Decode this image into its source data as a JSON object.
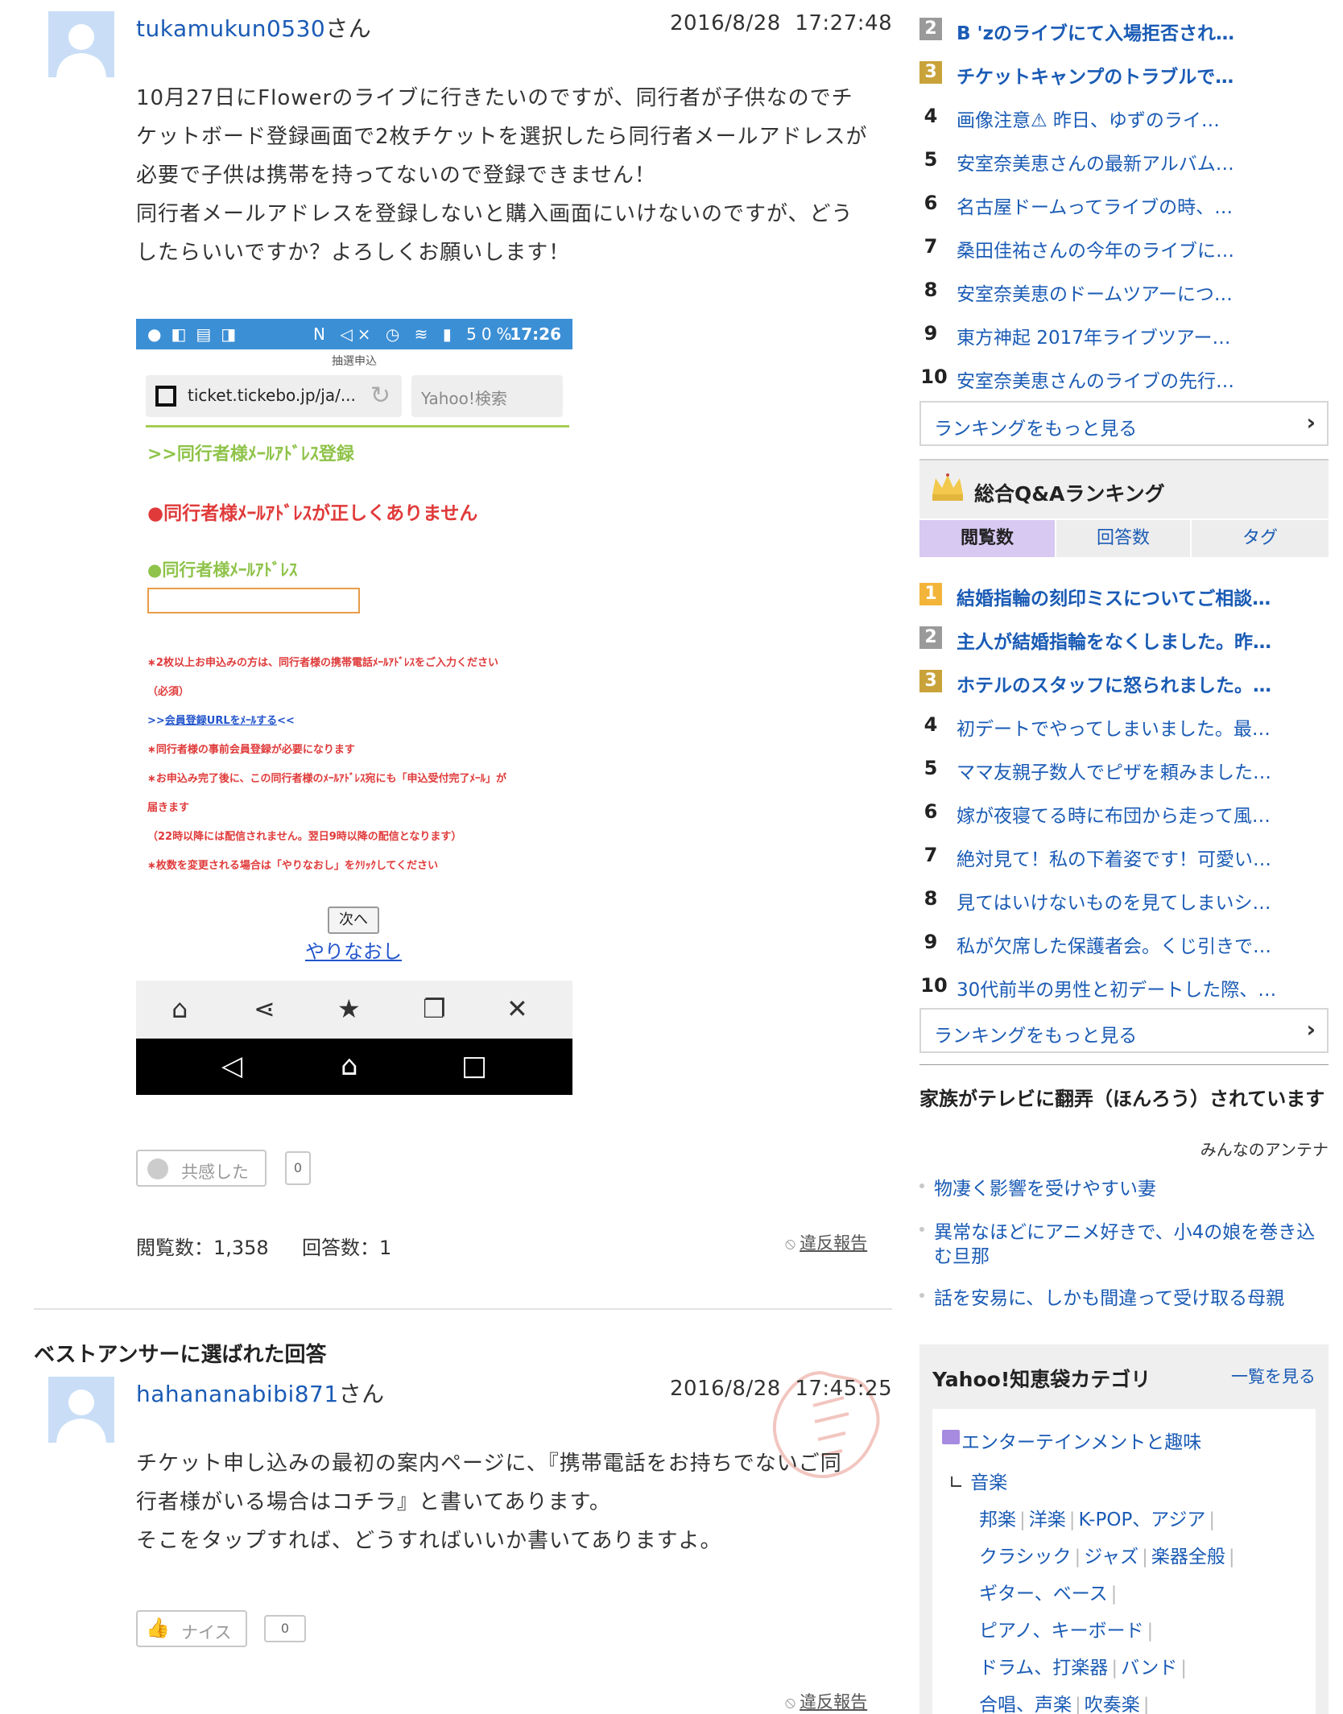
{
  "question": {
    "username": "tukamukun0530",
    "honorific": "さん",
    "timestamp": "2016/8/28  17:27:48",
    "body": [
      "10月27日にFlowerのライブに行きたいのですが、同行者が子供なのでチ",
      "ケットボード登録画面で2枚チケットを選択したら同行者メールアドレスが",
      "必要で子供は携帯を持ってないので登録できません！",
      "同行者メールアドレスを登録しないと購入画面にいけないのですが、どう",
      "したらいいですか？よろしくお願いします！"
    ],
    "empathy_label": "共感した",
    "empathy_count": "0",
    "views": "閲覧数：1,358",
    "answers": "回答数：1",
    "report": "違反報告"
  },
  "screenshot": {
    "status_time": "17:26",
    "status_battery": "50%",
    "page_title": "抽選申込",
    "url": "ticket.tickebo.jp/ja/...",
    "search_placeholder": "Yahoo!検索",
    "heading": ">>同行者様ﾒｰﾙｱﾄﾞﾚｽ登録",
    "error": "●同行者様ﾒｰﾙｱﾄﾞﾚｽが正しくありません",
    "field_label": "●同行者様ﾒｰﾙｱﾄﾞﾚｽ",
    "notes": [
      "∗2枚以上お申込みの方は、同行者様の携帯電話ﾒｰﾙｱﾄﾞﾚｽをご入力ください",
      "（必須）",
      "∗同行者様の事前会員登録が必要になります",
      "∗お申込み完了後に、この同行者様のﾒｰﾙｱﾄﾞﾚｽ宛にも「申込受付完了ﾒｰﾙ」が",
      "届きます",
      "（22時以降には配信されません。翌日9時以降の配信となります）",
      "∗枚数を変更される場合は「やりなおし」をｸﾘｯｸしてください"
    ],
    "register_prefix": ">>",
    "register_link": "会員登録URLをﾒｰﾙする",
    "register_suffix": "<<",
    "next_button": "次へ",
    "redo_link": "やりなおし"
  },
  "best_answer": {
    "heading": "ベストアンサーに選ばれた回答",
    "username": "hahananabibi871",
    "honorific": "さん",
    "timestamp": "2016/8/28  17:45:25",
    "body": [
      "チケット申し込みの最初の案内ページに、『携帯電話をお持ちでないご同",
      "行者様がいる場合はコチラ』と書いてあります。",
      "そこをタップすれば、どうすればいいか書いてありますよ。"
    ],
    "nice_label": "ナイス",
    "nice_count": "0",
    "report": "違反報告"
  },
  "ranking1": {
    "items": [
      {
        "num": "2",
        "text": "B 'zのライブにて入場拒否され…",
        "badge": "#9a9a9a",
        "bold": true
      },
      {
        "num": "3",
        "text": "チケットキャンプのトラブルで…",
        "badge": "#c9a23a",
        "bold": true
      },
      {
        "num": "4",
        "text": "画像注意⚠ 昨日、ゆずのライ…"
      },
      {
        "num": "5",
        "text": "安室奈美恵さんの最新アルバム…"
      },
      {
        "num": "6",
        "text": "名古屋ドームってライブの時、…"
      },
      {
        "num": "7",
        "text": "桑田佳祐さんの今年のライブに…"
      },
      {
        "num": "8",
        "text": "安室奈美恵のドームツアーにつ…"
      },
      {
        "num": "9",
        "text": "東方神起 2017年ライブツアー…"
      },
      {
        "num": "10",
        "text": "安室奈美恵さんのライブの先行…"
      }
    ],
    "more": "ランキングをもっと見る"
  },
  "ranking2": {
    "title": "総合Q&Aランキング",
    "tabs": [
      "閲覧数",
      "回答数",
      "タグ"
    ],
    "items": [
      {
        "num": "1",
        "text": "結婚指輪の刻印ミスについてご相談…",
        "badge": "#f2b53a",
        "bold": true
      },
      {
        "num": "2",
        "text": "主人が結婚指輪をなくしました。昨…",
        "badge": "#9a9a9a",
        "bold": true
      },
      {
        "num": "3",
        "text": "ホテルのスタッフに怒られました。…",
        "badge": "#c9a23a",
        "bold": true
      },
      {
        "num": "4",
        "text": "初デートでやってしまいました。最…"
      },
      {
        "num": "5",
        "text": "ママ友親子数人でピザを頼みました…"
      },
      {
        "num": "6",
        "text": "嫁が夜寝てる時に布団から走って風…"
      },
      {
        "num": "7",
        "text": "絶対見て！私の下着姿です！可愛い…"
      },
      {
        "num": "8",
        "text": "見てはいけないものを見てしまいシ…"
      },
      {
        "num": "9",
        "text": "私が欠席した保護者会。くじ引きで…"
      },
      {
        "num": "10",
        "text": "30代前半の男性と初デートした際、…"
      }
    ],
    "more": "ランキングをもっと見る"
  },
  "antenna": {
    "title": "家族がテレビに翻弄（ほんろう）されています",
    "source": "みんなのアンテナ",
    "items": [
      "物凄く影響を受けやすい妻",
      "異常なほどにアニメ好きで、小4の娘を巻き込む旦那",
      "話を安易に、しかも間違って受け取る母親"
    ]
  },
  "categories": {
    "title": "Yahoo!知恵袋カテゴリ",
    "all_link": "一覧を見る",
    "top": "エンターテインメントと趣味",
    "sub": "音楽",
    "rows": [
      [
        "邦楽",
        "洋楽",
        "K-POP、アジア"
      ],
      [
        "クラシック",
        "ジャズ",
        "楽器全般"
      ],
      [
        "ギター、ベース"
      ],
      [
        "ピアノ、キーボード"
      ],
      [
        "ドラム、打楽器",
        "バンド"
      ],
      [
        "合唱、声楽",
        "吹奏楽"
      ]
    ]
  }
}
